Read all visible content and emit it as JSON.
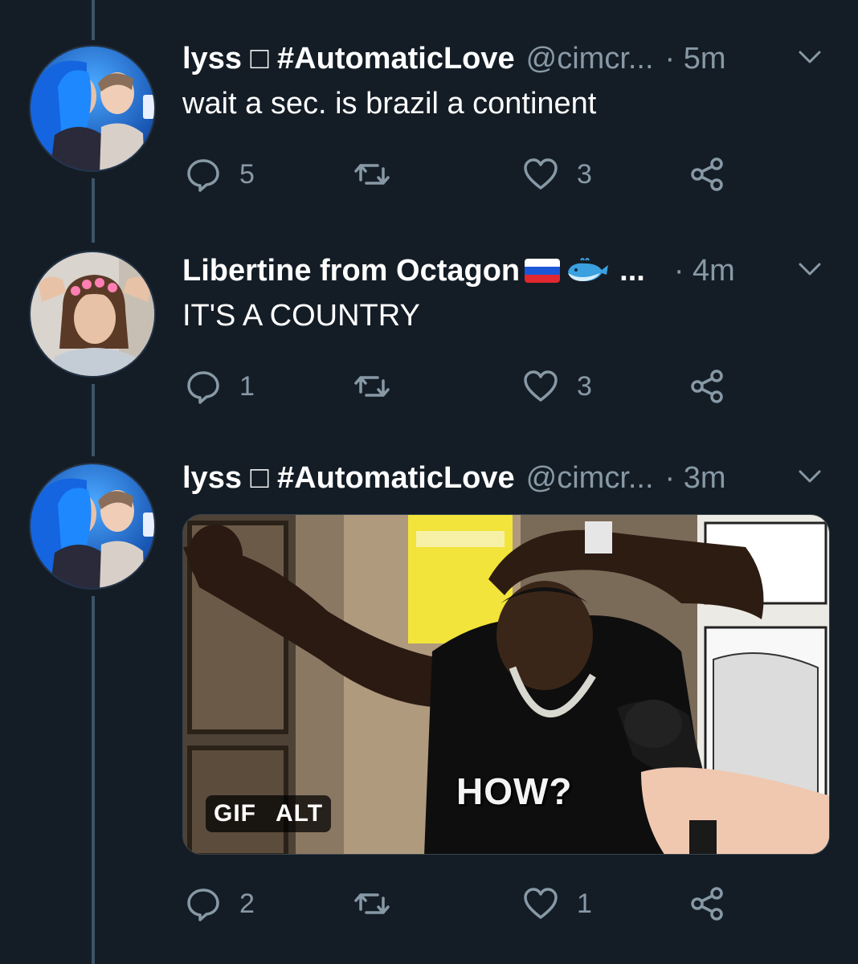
{
  "thread": {
    "tweets": [
      {
        "display_name": "lyss □ #AutomaticLove",
        "handle": "@cimcr...",
        "time": "· 5m",
        "text": "wait a sec. is brazil a continent",
        "avatar_icon": "avatar-photo-two-women",
        "actions": {
          "reply_count": "5",
          "retweet_count": "",
          "like_count": "3"
        }
      },
      {
        "display_name": "Libertine from Octagon",
        "name_emoji": [
          "russia-flag-icon",
          "whale-icon"
        ],
        "ellipsis": "...",
        "time": "· 4m",
        "text": "IT'S A COUNTRY",
        "avatar_icon": "avatar-photo-woman-flower-crown",
        "actions": {
          "reply_count": "1",
          "retweet_count": "",
          "like_count": "3"
        }
      },
      {
        "display_name": "lyss □ #AutomaticLove",
        "handle": "@cimcr...",
        "time": "· 3m",
        "text": "",
        "avatar_icon": "avatar-photo-two-women",
        "media": {
          "type": "gif",
          "badges": [
            "GIF",
            "ALT"
          ],
          "caption": "HOW?"
        },
        "actions": {
          "reply_count": "2",
          "retweet_count": "",
          "like_count": "1"
        }
      }
    ]
  },
  "icons": {
    "reply": "reply-icon",
    "retweet": "retweet-icon",
    "like": "heart-icon",
    "share": "share-icon",
    "menu": "chevron-down-icon"
  },
  "colors": {
    "background": "#141d26",
    "secondary_text": "#8899a6",
    "thread_line": "#3d5466"
  }
}
